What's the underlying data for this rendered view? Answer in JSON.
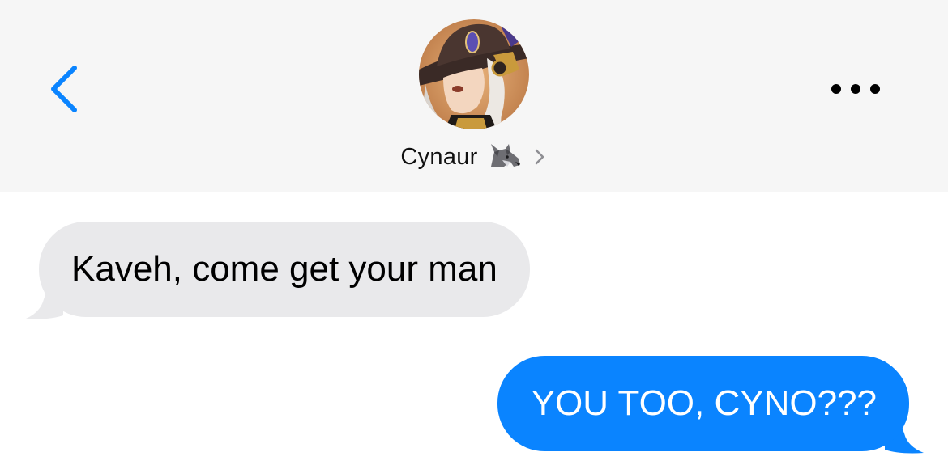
{
  "header": {
    "contact_name": "Cynaur",
    "contact_emoji": "wolf-emoji",
    "back_icon": "chevron-left-icon",
    "more_icon": "more-horizontal-icon",
    "avatar": "contact-avatar"
  },
  "messages": [
    {
      "direction": "received",
      "text": "Kaveh, come get your man"
    },
    {
      "direction": "sent",
      "text": "YOU TOO, CYNO???"
    }
  ],
  "colors": {
    "header_bg": "#f6f6f6",
    "accent_blue": "#0a84ff",
    "received_bubble": "#e9e9eb",
    "sent_text": "#ffffff",
    "received_text": "#000000"
  }
}
